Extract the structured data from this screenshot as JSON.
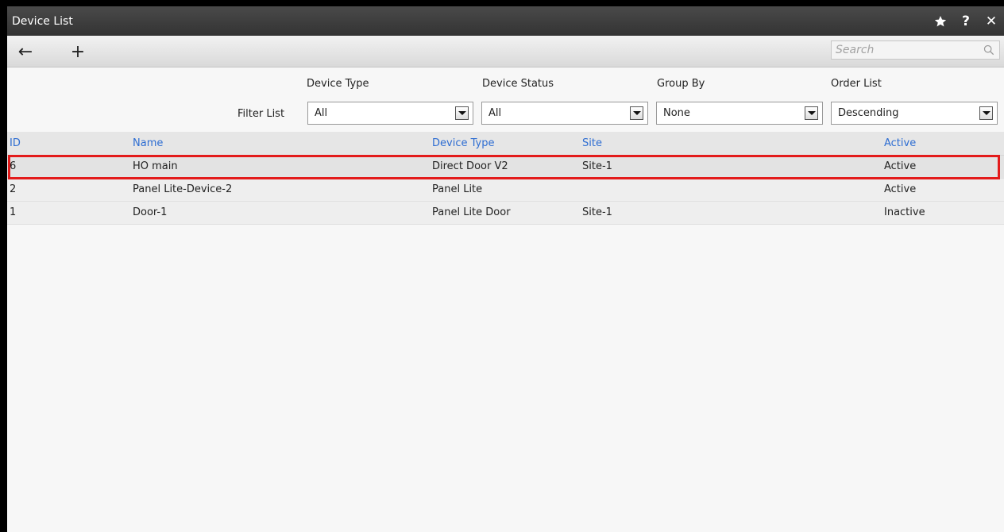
{
  "window": {
    "title": "Device List"
  },
  "titlebar": {
    "favorite_icon": "star-icon",
    "help_label": "?",
    "close_label": "✕"
  },
  "toolbar": {
    "back_icon": "back-arrow-icon",
    "add_icon": "plus-icon",
    "back_label": "←",
    "add_label": "+",
    "search": {
      "placeholder": "Search",
      "value": ""
    }
  },
  "filters": {
    "filter_list_label": "Filter List",
    "device_type": {
      "label": "Device Type",
      "value": "All"
    },
    "device_status": {
      "label": "Device Status",
      "value": "All"
    },
    "group_by": {
      "label": "Group By",
      "value": "None"
    },
    "order_list": {
      "label": "Order List",
      "value": "Descending"
    }
  },
  "table": {
    "columns": {
      "id": "ID",
      "name": "Name",
      "device_type": "Device Type",
      "site": "Site",
      "active": "Active"
    },
    "rows": [
      {
        "id": "6",
        "name": "HO main",
        "device_type": "Direct Door V2",
        "site": "Site-1",
        "active": "Active"
      },
      {
        "id": "2",
        "name": "Panel Lite-Device-2",
        "device_type": "Panel Lite",
        "site": "",
        "active": "Active"
      },
      {
        "id": "1",
        "name": "Door-1",
        "device_type": "Panel Lite Door",
        "site": "Site-1",
        "active": "Inactive"
      }
    ]
  },
  "colors": {
    "header_text": "#2d6dd2",
    "highlight": "#e31b1b",
    "titlebar": "#3c3c3c"
  }
}
